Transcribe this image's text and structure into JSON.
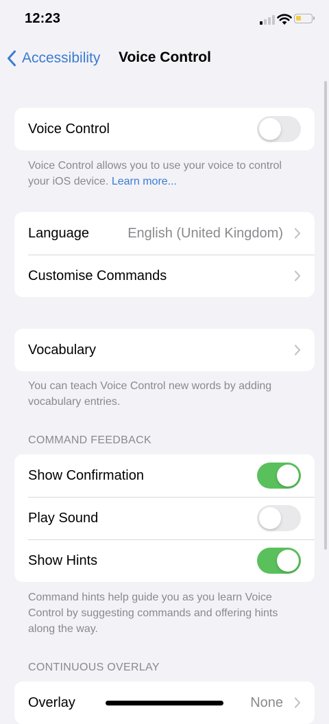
{
  "status": {
    "time": "12:23",
    "signal_bars_on": 1,
    "battery_level": 0.3,
    "battery_color": "#f4cd3c"
  },
  "nav": {
    "back_label": "Accessibility",
    "title": "Voice Control"
  },
  "voice_control": {
    "label": "Voice Control",
    "enabled": false
  },
  "voice_control_footer": {
    "text": "Voice Control allows you to use your voice to control your iOS device.",
    "link": "Learn more..."
  },
  "language_group": {
    "language_label": "Language",
    "language_value": "English (United Kingdom)",
    "customise_label": "Customise Commands"
  },
  "vocabulary": {
    "label": "Vocabulary",
    "footer": "You can teach Voice Control new words by adding vocabulary entries."
  },
  "command_feedback": {
    "header": "COMMAND FEEDBACK",
    "show_confirmation": {
      "label": "Show Confirmation",
      "enabled": true
    },
    "play_sound": {
      "label": "Play Sound",
      "enabled": false
    },
    "show_hints": {
      "label": "Show Hints",
      "enabled": true
    },
    "footer": "Command hints help guide you as you learn Voice Control by suggesting commands and offering hints along the way."
  },
  "continuous_overlay": {
    "header": "CONTINUOUS OVERLAY",
    "overlay_label": "Overlay",
    "overlay_value": "None"
  },
  "colors": {
    "accent": "#3b7bd1",
    "toggle_on": "#59c05c",
    "toggle_off": "#e9e9eb",
    "background": "#f2f2f7"
  }
}
